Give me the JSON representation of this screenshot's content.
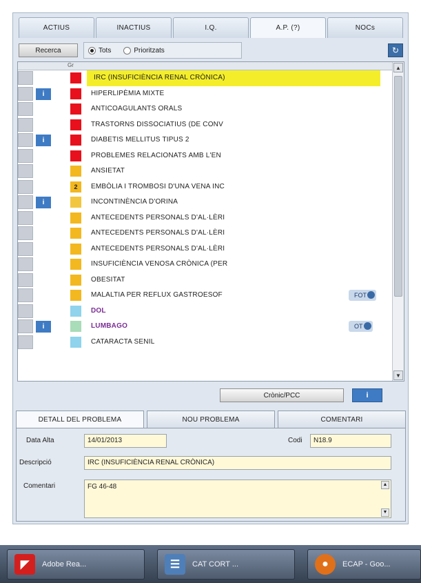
{
  "tabs": [
    {
      "label": "ACTIUS"
    },
    {
      "label": "INACTIUS"
    },
    {
      "label": "I.Q."
    },
    {
      "label": "A.P. (?)"
    },
    {
      "label": "NOCs"
    }
  ],
  "filter": {
    "search_label": "Recerca",
    "radio_all": "Tots",
    "radio_prioritized": "Prioritzats",
    "refresh_icon": "refresh-icon"
  },
  "grid": {
    "header_label": "Gr",
    "rows": [
      {
        "sev_color": "#e8101c",
        "sev_label": "",
        "info": false,
        "desc": "IRC (INSUFICIÈNCIA RENAL CRÒNICA)",
        "selected": true
      },
      {
        "sev_color": "#e8101c",
        "sev_label": "",
        "info": true,
        "info_label": "i",
        "desc": "HIPERLIPÈMIA MIXTE"
      },
      {
        "sev_color": "#e8101c",
        "sev_label": "",
        "info": false,
        "desc": "ANTICOAGULANTS ORALS"
      },
      {
        "sev_color": "#e8101c",
        "sev_label": "",
        "info": false,
        "desc": "TRASTORNS DISSOCIATIUS (DE CONV"
      },
      {
        "sev_color": "#e8101c",
        "sev_label": "",
        "info": true,
        "info_label": "i",
        "desc": "DIABETIS MELLITUS TIPUS 2"
      },
      {
        "sev_color": "#e8101c",
        "sev_label": "",
        "info": false,
        "desc": "PROBLEMES RELACIONATS AMB L'EN"
      },
      {
        "sev_color": "#f3b81f",
        "sev_label": "",
        "info": false,
        "desc": "ANSIETAT"
      },
      {
        "sev_color": "#f3b81f",
        "sev_label": "2",
        "info": false,
        "desc": "EMBÒLIA I TROMBOSI D'UNA VENA INC"
      },
      {
        "sev_color": "#f3c640",
        "sev_label": "",
        "info": true,
        "info_label": "i",
        "desc": "INCONTINÈNCIA D'ORINA"
      },
      {
        "sev_color": "#f3b81f",
        "sev_label": "",
        "info": false,
        "desc": "ANTECEDENTS PERSONALS D'AL·LÈRI"
      },
      {
        "sev_color": "#f3b81f",
        "sev_label": "",
        "info": false,
        "desc": "ANTECEDENTS PERSONALS D'AL·LÈRI"
      },
      {
        "sev_color": "#f3b81f",
        "sev_label": "",
        "info": false,
        "desc": "ANTECEDENTS PERSONALS D'AL·LÈRI"
      },
      {
        "sev_color": "#f3b81f",
        "sev_label": "",
        "info": false,
        "desc": "INSUFICIÈNCIA VENOSA CRÒNICA (PER"
      },
      {
        "sev_color": "#f3b81f",
        "sev_label": "",
        "info": false,
        "desc": "OBESITAT"
      },
      {
        "sev_color": "#f3b81f",
        "sev_label": "",
        "info": false,
        "desc": "MALALTIA PER REFLUX GASTROESOF",
        "tag": "FOT"
      },
      {
        "sev_color": "#8fd3ec",
        "sev_label": "",
        "info": false,
        "desc": "DOL",
        "purple": true
      },
      {
        "sev_color": "#a9dcb8",
        "sev_label": "",
        "info": true,
        "info_label": "i",
        "desc": "LUMBAGO",
        "purple": true,
        "tag": "OT"
      },
      {
        "sev_color": "#8fd3ec",
        "sev_label": "",
        "info": false,
        "desc": "CATARACTA SENIL"
      }
    ]
  },
  "cronic_button": "Crònic/PCC",
  "info_button": "i",
  "bottom_tabs": [
    {
      "label": "DETALL DEL PROBLEMA"
    },
    {
      "label": "NOU PROBLEMA"
    },
    {
      "label": "COMENTARI"
    }
  ],
  "detail": {
    "date_label": "Data Alta",
    "date_value": "14/01/2013",
    "code_label": "Codi",
    "code_value": "N18.9",
    "desc_label": "Descripció",
    "desc_value": "IRC (INSUFICIÈNCIA RENAL CRÒNICA)",
    "comment_label": "Comentari",
    "comment_value": "FG 46-48"
  },
  "taskbar": [
    {
      "label": "Adobe Rea...",
      "icon": "pdf-icon",
      "color": "#d3201f"
    },
    {
      "label": "CAT CORT ...",
      "icon": "document-icon",
      "color": "#4f7fb8"
    },
    {
      "label": "ECAP - Goo...",
      "icon": "firefox-icon",
      "color": "#e0701a"
    }
  ]
}
